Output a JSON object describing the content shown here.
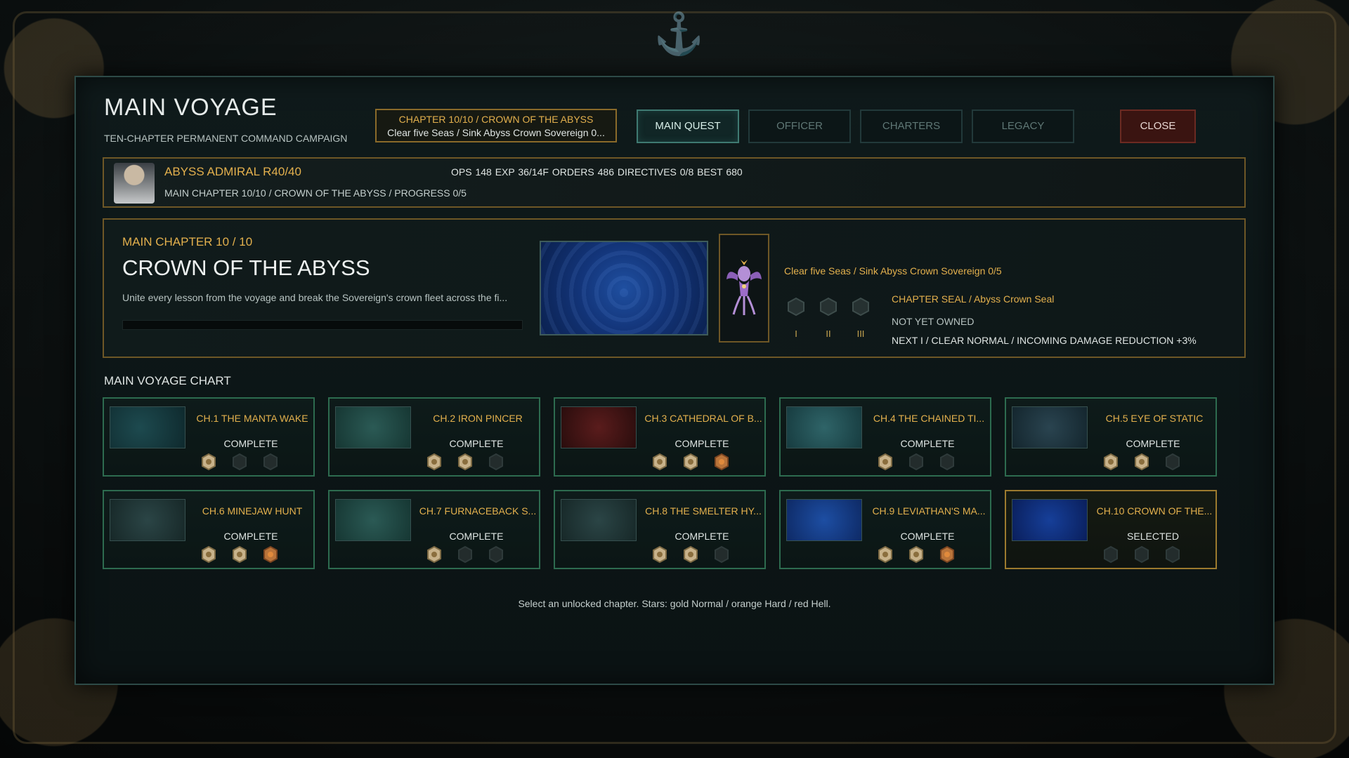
{
  "header": {
    "title": "MAIN VOYAGE",
    "subtitle": "TEN-CHAPTER PERMANENT COMMAND CAMPAIGN",
    "chapter_box_line1": "CHAPTER 10/10 / CROWN OF THE ABYSS",
    "chapter_box_line2": "Clear five Seas / Sink Abyss Crown Sovereign 0...",
    "tabs": [
      {
        "label": "MAIN QUEST",
        "active": true
      },
      {
        "label": "OFFICER",
        "active": false
      },
      {
        "label": "CHARTERS",
        "active": false
      },
      {
        "label": "LEGACY",
        "active": false
      }
    ],
    "close_label": "CLOSE"
  },
  "profile": {
    "name_rank": "ABYSS ADMIRAL  R40/40",
    "stats": "OPS 148  EXP 36/14F  ORDERS 486  DIRECTIVES 0/8  BEST 680",
    "chapter_line": "MAIN CHAPTER 10/10  /  CROWN OF THE ABYSS  /  PROGRESS 0/5"
  },
  "feature": {
    "label": "MAIN CHAPTER 10 / 10",
    "title": "CROWN OF THE ABYSS",
    "description": "Unite every lesson from the voyage and break the Sovereign's crown fleet across the fi...",
    "progress": 0,
    "objective": "Clear five Seas / Sink Abyss Crown Sovereign  0/5",
    "seal": "CHAPTER SEAL / Abyss Crown Seal",
    "owned": "NOT YET OWNED",
    "next": "NEXT I  /  CLEAR NORMAL  /  INCOMING DAMAGE REDUCTION +3%",
    "seal_levels": [
      "I",
      "II",
      "III"
    ]
  },
  "chart_title": "MAIN VOYAGE CHART",
  "chapters": [
    {
      "name": "CH.1  THE MANTA WAKE",
      "status": "COMPLETE",
      "stars": [
        1,
        0,
        0
      ],
      "thumb": "teal"
    },
    {
      "name": "CH.2  IRON PINCER",
      "status": "COMPLETE",
      "stars": [
        1,
        1,
        0
      ],
      "thumb": "green"
    },
    {
      "name": "CH.3  CATHEDRAL OF B...",
      "status": "COMPLETE",
      "stars": [
        1,
        1,
        2
      ],
      "thumb": "red"
    },
    {
      "name": "CH.4  THE CHAINED TI...",
      "status": "COMPLETE",
      "stars": [
        1,
        0,
        0
      ],
      "thumb": "cyan"
    },
    {
      "name": "CH.5  EYE OF STATIC",
      "status": "COMPLETE",
      "stars": [
        1,
        1,
        0
      ],
      "thumb": "slate"
    },
    {
      "name": "CH.6  MINEJAW HUNT",
      "status": "COMPLETE",
      "stars": [
        1,
        1,
        2
      ],
      "thumb": "grayteal"
    },
    {
      "name": "CH.7  FURNACEBACK S...",
      "status": "COMPLETE",
      "stars": [
        1,
        0,
        0
      ],
      "thumb": "green"
    },
    {
      "name": "CH.8  THE SMELTER HY...",
      "status": "COMPLETE",
      "stars": [
        1,
        1,
        0
      ],
      "thumb": "grayteal"
    },
    {
      "name": "CH.9  LEVIATHAN'S MA...",
      "status": "COMPLETE",
      "stars": [
        1,
        1,
        2
      ],
      "thumb": "blue"
    },
    {
      "name": "CH.10  CROWN OF THE...",
      "status": "SELECTED",
      "stars": [
        0,
        0,
        0
      ],
      "thumb": "deepblue",
      "selected": true
    }
  ],
  "hint": "Select an unlocked chapter. Stars: gold Normal / orange Hard / red Hell.",
  "colors": {
    "gold": "#e3b04d",
    "accent": "#3f7a72",
    "close": "#3a1411"
  }
}
